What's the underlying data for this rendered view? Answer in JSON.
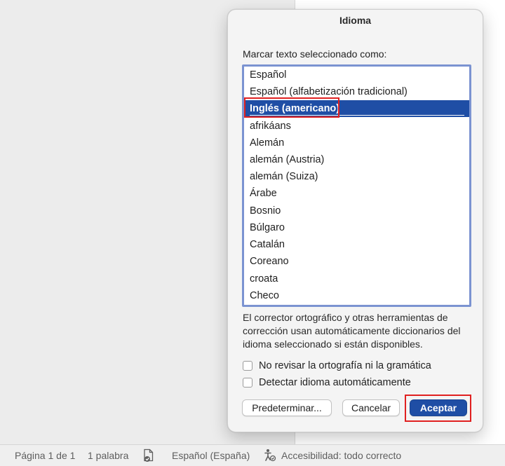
{
  "dialog": {
    "title": "Idioma",
    "prompt": "Marcar texto seleccionado como:",
    "languages": [
      "Español",
      "Español (alfabetización tradicional)",
      "Inglés (americano)",
      "afrikáans",
      "Alemán",
      "alemán (Austria)",
      "alemán (Suiza)",
      "Árabe",
      "Bosnio",
      "Búlgaro",
      "Catalán",
      "Coreano",
      "croata",
      "Checo"
    ],
    "selected_language": "Inglés (americano)",
    "description": "El corrector ortográfico y otras herramientas de corrección usan automáticamente diccionarios del idioma seleccionado si están disponibles.",
    "checkboxes": {
      "no_spellcheck": {
        "label": "No revisar la ortografía ni la gramática",
        "checked": false
      },
      "auto_detect": {
        "label": "Detectar idioma automáticamente",
        "checked": false
      }
    },
    "buttons": {
      "default": "Predeterminar...",
      "cancel": "Cancelar",
      "accept": "Aceptar"
    }
  },
  "status_bar": {
    "page": "Página 1 de 1",
    "words": "1 palabra",
    "proofing_icon": "document-check-icon",
    "language": "Español (España)",
    "accessibility_icon": "accessibility-icon",
    "accessibility": "Accesibilidad: todo correcto"
  },
  "colors": {
    "accent": "#1f4ea5",
    "list_border": "#7b93d1",
    "highlight": "#e02020"
  }
}
